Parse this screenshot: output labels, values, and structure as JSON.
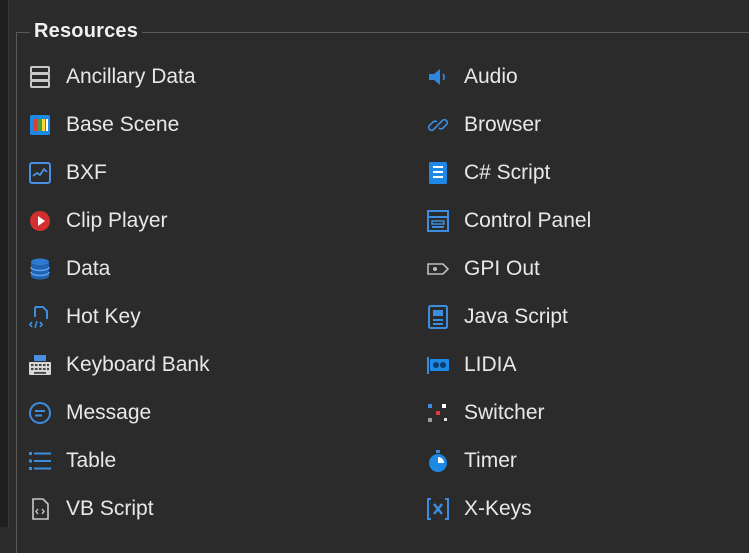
{
  "group": {
    "title": "Resources"
  },
  "left": [
    {
      "key": "ancillary",
      "label": "Ancillary Data",
      "icon": "server-stack-icon"
    },
    {
      "key": "basescene",
      "label": "Base Scene",
      "icon": "base-scene-icon"
    },
    {
      "key": "bxf",
      "label": "BXF",
      "icon": "chart-line-icon"
    },
    {
      "key": "clip",
      "label": "Clip Player",
      "icon": "play-circle-icon"
    },
    {
      "key": "data",
      "label": "Data",
      "icon": "database-icon"
    },
    {
      "key": "hotkey",
      "label": "Hot Key",
      "icon": "document-code-icon"
    },
    {
      "key": "kbank",
      "label": "Keyboard Bank",
      "icon": "keyboard-icon"
    },
    {
      "key": "message",
      "label": "Message",
      "icon": "message-icon"
    },
    {
      "key": "table",
      "label": "Table",
      "icon": "list-icon"
    },
    {
      "key": "vbscript",
      "label": "VB Script",
      "icon": "vb-file-icon"
    }
  ],
  "right": [
    {
      "key": "audio",
      "label": "Audio",
      "icon": "speaker-icon"
    },
    {
      "key": "browser",
      "label": "Browser",
      "icon": "link-icon"
    },
    {
      "key": "csharp",
      "label": "C# Script",
      "icon": "csharp-file-icon"
    },
    {
      "key": "controlpanel",
      "label": "Control Panel",
      "icon": "control-panel-icon"
    },
    {
      "key": "gpiout",
      "label": "GPI Out",
      "icon": "gpi-out-icon"
    },
    {
      "key": "javascript",
      "label": "Java Script",
      "icon": "js-file-icon"
    },
    {
      "key": "lidia",
      "label": "LIDIA",
      "icon": "lidia-icon"
    },
    {
      "key": "switcher",
      "label": "Switcher",
      "icon": "switcher-icon"
    },
    {
      "key": "timer",
      "label": "Timer",
      "icon": "stopwatch-icon"
    },
    {
      "key": "xkeys",
      "label": "X-Keys",
      "icon": "x-keys-icon"
    }
  ]
}
